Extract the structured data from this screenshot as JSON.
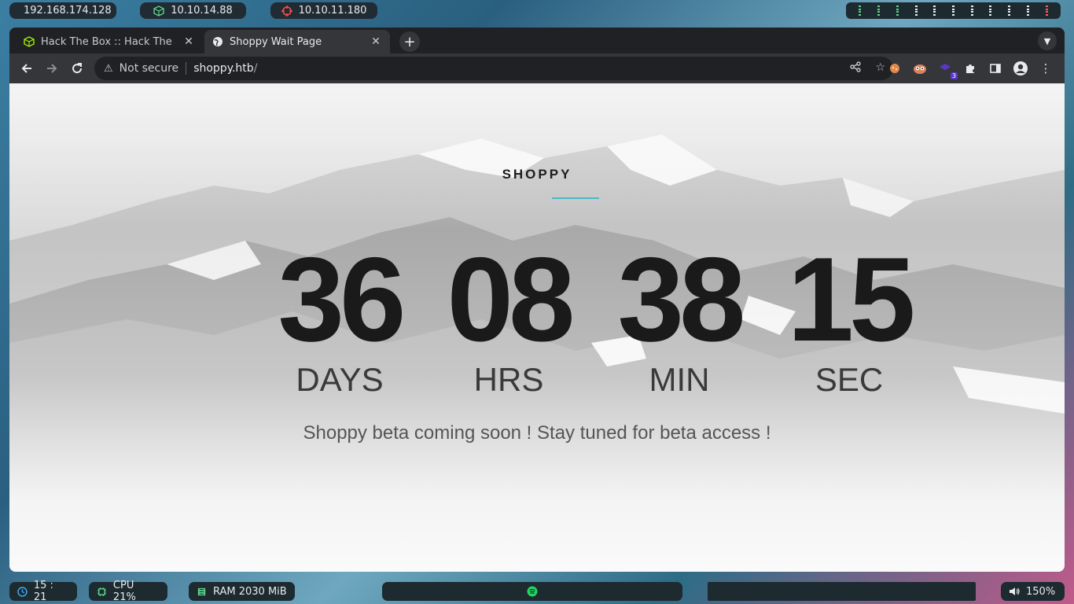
{
  "topbar": {
    "local_ip": "192.168.174.128",
    "vpn_ip": "10.10.14.88",
    "target_ip": "10.10.11.180",
    "icons": [
      "skull-icon",
      "cube-icon",
      "target-icon"
    ]
  },
  "browser": {
    "tabs": [
      {
        "title": "Hack The Box :: Hack The B",
        "icon": "htb-cube-icon",
        "active": false
      },
      {
        "title": "Shoppy Wait Page",
        "icon": "globe-icon",
        "active": true
      }
    ],
    "address": {
      "security": "Not secure",
      "host": "shoppy.htb",
      "path": "/"
    },
    "extension_badge": "3"
  },
  "page": {
    "brand": "SHOPPY",
    "countdown": [
      {
        "value": "36",
        "unit": "DAYS"
      },
      {
        "value": "08",
        "unit": "HRS"
      },
      {
        "value": "38",
        "unit": "MIN"
      },
      {
        "value": "15",
        "unit": "SEC"
      }
    ],
    "message": "Shoppy beta coming soon ! Stay tuned for beta access !"
  },
  "bottombar": {
    "clock": "15 : 21",
    "cpu": "CPU 21%",
    "ram": "RAM 2030 MiB",
    "volume": "150%"
  },
  "colors": {
    "accent_line": "#4bb8c8",
    "ws_green": "#5fd38a",
    "ws_red": "#ff5d5d"
  }
}
